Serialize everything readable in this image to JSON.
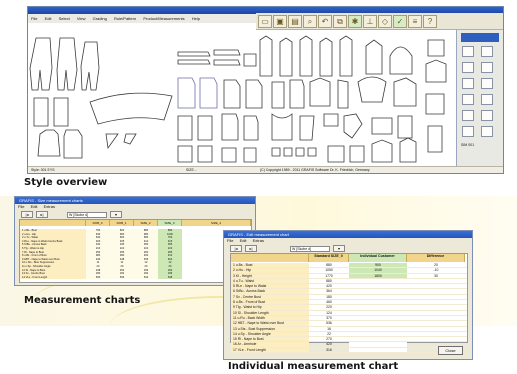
{
  "sections": {
    "style_overview": "Style overview",
    "measurement_charts": "Measurement charts",
    "individual_chart": "Individual measurement chart"
  },
  "cad_window": {
    "menu": [
      "File",
      "Edit",
      "Select",
      "View",
      "Grading",
      "Rule/Pattern",
      "Product/Measurements",
      "Help"
    ],
    "toolbar_icons": [
      "folder-icon",
      "save-icon",
      "print-icon",
      "zoom-icon",
      "undo-icon",
      "copy-icon",
      "settings-icon",
      "ruler-icon",
      "grade-icon",
      "check-icon",
      "list-icon",
      "help-icon"
    ],
    "status_left": "Style: 001 EYS",
    "status_mid": "SIZE...",
    "status_right": "(C) Copyright 1989 - 2011 GRAFIS Software Dr. K. Friedrich, Germany",
    "side_label": "SIM  001"
  },
  "measurement_window": {
    "title": "GRAFIS - Size measurement charts",
    "menu": [
      "File",
      "Edit",
      "Extras"
    ],
    "selector": "W  [Skobe d]",
    "columns": [
      "",
      "DOB_0",
      "DOB_1",
      "SIZE_2",
      "SIZE_3",
      "SIZE_4"
    ],
    "rows": [
      {
        "name": "1  u.Bs - Bust",
        "values": [
          "790",
          "820",
          "880",
          "890"
        ]
      },
      {
        "name": "2  u.Hu - Hip",
        "values": [
          "940",
          "960",
          "980",
          "1000"
        ]
      },
      {
        "name": "3  u.Tu - Waist",
        "values": [
          "640",
          "660",
          "680",
          "700"
        ]
      },
      {
        "name": "4  RLe - Nape to Waist Centre Back",
        "values": [
          "400",
          "405",
          "410",
          "415"
        ]
      },
      {
        "name": "5  SrBu - Across Back",
        "values": [
          "340",
          "345",
          "350",
          "355"
        ]
      },
      {
        "name": "6  Tlg - Waist to Hip",
        "values": [
          "210",
          "210",
          "210",
          "210"
        ]
      },
      {
        "name": "7  Rl - Nape to Bust",
        "values": [
          "250",
          "255",
          "260",
          "265"
        ]
      },
      {
        "name": "8  u.Bs - Front of Bust",
        "values": [
          "380",
          "390",
          "400",
          "410"
        ]
      },
      {
        "name": "9  HBT - Nape to Waist over Bust",
        "values": [
          "440",
          "448",
          "456",
          "464"
        ]
      },
      {
        "name": "10  u.Sts - Bust Suppression",
        "values": [
          "11",
          "11",
          "12",
          "12"
        ]
      },
      {
        "name": "11  u.Sp - Shoulder Angle",
        "values": [
          "20",
          "20",
          "20",
          "20"
        ]
      },
      {
        "name": "12  Sl - Nape to Bust",
        "values": [
          "248",
          "252",
          "256",
          "260"
        ]
      },
      {
        "name": "13  Sv - Centre Bust",
        "values": [
          "180",
          "182",
          "184",
          "186"
        ]
      },
      {
        "name": "14  VLe - Front Length",
        "values": [
          "530",
          "536",
          "542",
          "548"
        ]
      }
    ]
  },
  "individual_window": {
    "title": "GRAFIS - Edit measurement chart",
    "menu": [
      "File",
      "Edit",
      "Extras"
    ],
    "selector": "W  [Skobe d]",
    "columns": [
      "",
      "Standard  SIZE_0",
      "Individual  Customer",
      "Difference"
    ],
    "rows": [
      {
        "name": "1  u.Bs - Bust",
        "std": "880",
        "ind": "900",
        "diff": "20"
      },
      {
        "name": "2  u.Hu - Hip",
        "std": "1050",
        "ind": "1040",
        "diff": "-10"
      },
      {
        "name": "3  Kl - Height",
        "std": "1770",
        "ind": "1800",
        "diff": "30"
      },
      {
        "name": "4  u.Tu - Waist",
        "std": "880",
        "ind": "",
        "diff": ""
      },
      {
        "name": "5  RLe - Nape to Waist",
        "std": "420",
        "ind": "",
        "diff": ""
      },
      {
        "name": "6  SrBu - Across Back",
        "std": "364",
        "ind": "",
        "diff": ""
      },
      {
        "name": "7  Sv - Centre Bust",
        "std": "180",
        "ind": "",
        "diff": ""
      },
      {
        "name": "8  u.Bs - Front of Bust",
        "std": "460",
        "ind": "",
        "diff": ""
      },
      {
        "name": "9  Tlg - Waist to Hip",
        "std": "220",
        "ind": "",
        "diff": ""
      },
      {
        "name": "10  Sl - Shoulder Length",
        "std": "124",
        "ind": "",
        "diff": ""
      },
      {
        "name": "11  u.Ru - Back Width",
        "std": "370",
        "ind": "",
        "diff": ""
      },
      {
        "name": "12  HBT - Nape to Waist over Bust",
        "std": "536",
        "ind": "",
        "diff": ""
      },
      {
        "name": "13  u.Sts - Bust Suppression",
        "std": "16",
        "ind": "",
        "diff": ""
      },
      {
        "name": "14  u.Sp - Shoulder Angle",
        "std": "22",
        "ind": "",
        "diff": ""
      },
      {
        "name": "15  Rl - Nape to Bust",
        "std": "270",
        "ind": "",
        "diff": ""
      },
      {
        "name": "16  Ar - Armhole",
        "std": "420",
        "ind": "",
        "diff": ""
      },
      {
        "name": "17  VLe - Front Length",
        "std": "316",
        "ind": "",
        "diff": ""
      }
    ],
    "close_label": "Close"
  }
}
